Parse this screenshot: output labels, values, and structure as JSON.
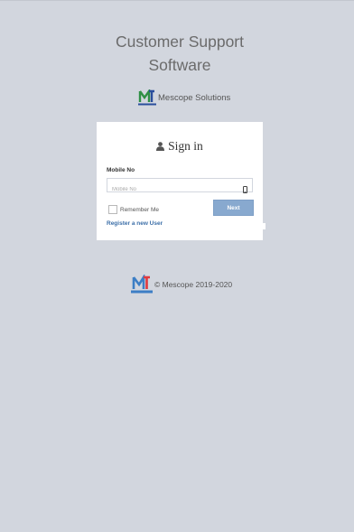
{
  "header": {
    "title_line1": "Customer Support",
    "title_line2": "Software",
    "company_name": "Mescope Solutions"
  },
  "login": {
    "heading": "Sign in",
    "mobile_label": "Mobile No",
    "mobile_placeholder": "Mobile No",
    "mobile_value": "",
    "remember_label": "Remember Me",
    "remember_checked": false,
    "next_label": "Next",
    "register_link": "Register a new User"
  },
  "footer": {
    "copyright": "© Mescope 2019-2020"
  },
  "icons": {
    "user": "user-icon",
    "phone": "mobile-phone-icon",
    "logo": "mescope-logo-icon"
  },
  "colors": {
    "background": "#d2d6de",
    "card": "#ffffff",
    "button": "#88a9cf",
    "link": "#3c6fa8"
  }
}
